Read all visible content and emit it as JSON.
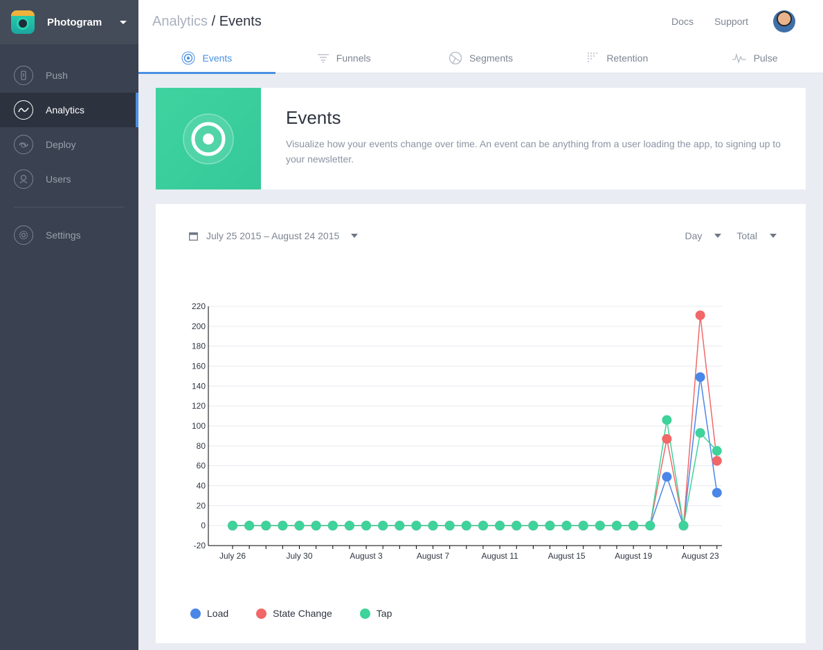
{
  "app": {
    "name": "Photogram"
  },
  "sidebar": {
    "items": [
      {
        "label": "Push",
        "icon": "push-icon"
      },
      {
        "label": "Analytics",
        "icon": "analytics-icon",
        "active": true
      },
      {
        "label": "Deploy",
        "icon": "deploy-icon"
      },
      {
        "label": "Users",
        "icon": "users-icon"
      }
    ],
    "settings": {
      "label": "Settings",
      "icon": "settings-icon"
    }
  },
  "header": {
    "breadcrumb_parent": "Analytics",
    "breadcrumb_sep": " / ",
    "breadcrumb_current": "Events",
    "links": {
      "docs": "Docs",
      "support": "Support"
    }
  },
  "tabs": [
    {
      "label": "Events",
      "icon": "target-icon",
      "active": true
    },
    {
      "label": "Funnels",
      "icon": "funnel-icon"
    },
    {
      "label": "Segments",
      "icon": "segments-icon"
    },
    {
      "label": "Retention",
      "icon": "retention-icon"
    },
    {
      "label": "Pulse",
      "icon": "pulse-icon"
    }
  ],
  "hero": {
    "title": "Events",
    "description": "Visualize how your events change over time. An event can be anything from a user loading the app, to signing up to your newsletter."
  },
  "filters": {
    "date_range": "July 25 2015 – August 24 2015",
    "interval": "Day",
    "aggregation": "Total"
  },
  "colors": {
    "accent": "#4a90e2",
    "load": "#4a86e8",
    "state_change": "#f26767",
    "tap": "#3ed39b"
  },
  "chart_data": {
    "type": "line",
    "x": [
      "July 26",
      "July 27",
      "July 28",
      "July 29",
      "July 30",
      "July 31",
      "August 1",
      "August 2",
      "August 3",
      "August 4",
      "August 5",
      "August 6",
      "August 7",
      "August 8",
      "August 9",
      "August 10",
      "August 11",
      "August 12",
      "August 13",
      "August 14",
      "August 15",
      "August 16",
      "August 17",
      "August 18",
      "August 19",
      "August 20",
      "August 21",
      "August 22",
      "August 23",
      "August 24"
    ],
    "tick_labels": [
      "July 26",
      "July 30",
      "August 3",
      "August 7",
      "August 11",
      "August 15",
      "August 19",
      "August 23"
    ],
    "series": [
      {
        "name": "Load",
        "color": "#4a86e8",
        "values": [
          0,
          0,
          0,
          0,
          0,
          0,
          0,
          0,
          0,
          0,
          0,
          0,
          0,
          0,
          0,
          0,
          0,
          0,
          0,
          0,
          0,
          0,
          0,
          0,
          0,
          0,
          49,
          0,
          149,
          33
        ]
      },
      {
        "name": "State Change",
        "color": "#f26767",
        "values": [
          0,
          0,
          0,
          0,
          0,
          0,
          0,
          0,
          0,
          0,
          0,
          0,
          0,
          0,
          0,
          0,
          0,
          0,
          0,
          0,
          0,
          0,
          0,
          0,
          0,
          0,
          87,
          0,
          211,
          65
        ]
      },
      {
        "name": "Tap",
        "color": "#3ed39b",
        "values": [
          0,
          0,
          0,
          0,
          0,
          0,
          0,
          0,
          0,
          0,
          0,
          0,
          0,
          0,
          0,
          0,
          0,
          0,
          0,
          0,
          0,
          0,
          0,
          0,
          0,
          0,
          106,
          0,
          93,
          75
        ]
      }
    ],
    "yticks": [
      -20,
      0,
      20,
      40,
      60,
      80,
      100,
      120,
      140,
      160,
      180,
      200,
      220
    ],
    "ylim": [
      -20,
      220
    ],
    "grid": true,
    "legend": "bottom-left"
  }
}
